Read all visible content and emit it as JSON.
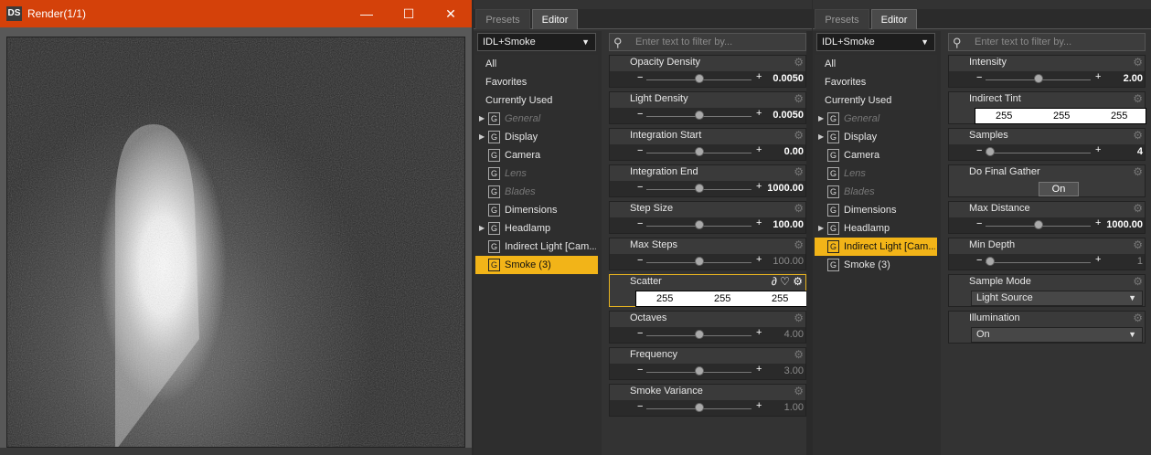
{
  "render_window": {
    "logo": "DS",
    "title": "Render(1/1)",
    "minimize": "—",
    "maximize": "☐",
    "close": "✕"
  },
  "left_pane": {
    "tabs": [
      {
        "label": "Presets"
      },
      {
        "label": "Editor"
      }
    ],
    "dropdown": "IDL+Smoke",
    "filter_placeholder": "Enter text to filter by...",
    "categories": [
      {
        "label": "All"
      },
      {
        "label": "Favorites"
      },
      {
        "label": "Currently Used"
      }
    ],
    "groups": [
      {
        "label": "General",
        "has_arrow": true,
        "dim": true
      },
      {
        "label": "Display",
        "has_arrow": true
      },
      {
        "label": "Camera"
      },
      {
        "label": "Lens",
        "dim": true
      },
      {
        "label": "Blades",
        "dim": true
      },
      {
        "label": "Dimensions"
      },
      {
        "label": "Headlamp",
        "has_arrow": true
      },
      {
        "label": "Indirect Light [Cam..."
      },
      {
        "label": "Smoke (3)",
        "selected": true
      }
    ],
    "properties": [
      {
        "name": "Opacity Density",
        "value": "0.0050",
        "level": 0.5
      },
      {
        "name": "Light Density",
        "value": "0.0050",
        "level": 0.5
      },
      {
        "name": "Integration Start",
        "value": "0.00",
        "level": 0.5
      },
      {
        "name": "Integration End",
        "value": "1000.00",
        "level": 0.5
      },
      {
        "name": "Step Size",
        "value": "100.00",
        "level": 0.5
      },
      {
        "name": "Max Steps",
        "value": "100.00",
        "level": 0.5,
        "dim": true
      },
      {
        "name": "Scatter",
        "color": [
          "255",
          "255",
          "255"
        ]
      },
      {
        "name": "Octaves",
        "value": "4.00",
        "level": 0.5,
        "dim": true
      },
      {
        "name": "Frequency",
        "value": "3.00",
        "level": 0.5,
        "dim": true
      },
      {
        "name": "Smoke Variance",
        "value": "1.00",
        "level": 0.5,
        "dim": true
      }
    ]
  },
  "right_pane": {
    "tabs": [
      {
        "label": "Presets"
      },
      {
        "label": "Editor"
      }
    ],
    "dropdown": "IDL+Smoke",
    "filter_placeholder": "Enter text to filter by...",
    "categories": [
      {
        "label": "All"
      },
      {
        "label": "Favorites"
      },
      {
        "label": "Currently Used"
      }
    ],
    "groups": [
      {
        "label": "General",
        "has_arrow": true,
        "dim": true
      },
      {
        "label": "Display",
        "has_arrow": true
      },
      {
        "label": "Camera"
      },
      {
        "label": "Lens",
        "dim": true
      },
      {
        "label": "Blades",
        "dim": true
      },
      {
        "label": "Dimensions"
      },
      {
        "label": "Headlamp",
        "has_arrow": true
      },
      {
        "label": "Indirect Light [Cam...",
        "selected": true
      },
      {
        "label": "Smoke (3)"
      }
    ],
    "properties": [
      {
        "name": "Intensity",
        "value": "2.00",
        "level": 0.5
      },
      {
        "name": "Indirect Tint",
        "color": [
          "255",
          "255",
          "255"
        ]
      },
      {
        "name": "Samples",
        "value": "4",
        "level": 0.0
      },
      {
        "name": "Do Final Gather",
        "toggle": "On"
      },
      {
        "name": "Max Distance",
        "value": "1000.00",
        "level": 0.5
      },
      {
        "name": "Min Depth",
        "value": "1",
        "level": 0.0,
        "dim": true
      },
      {
        "name": "Sample Mode",
        "select": "Light Source"
      },
      {
        "name": "Illumination",
        "select": "On"
      }
    ]
  }
}
